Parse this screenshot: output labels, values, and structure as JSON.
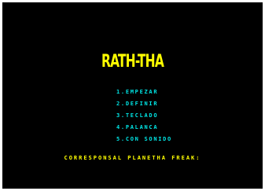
{
  "game": {
    "title": "RATH-THA",
    "menu": [
      {
        "label": "1.EMPEZAR"
      },
      {
        "label": "2.DEFINIR"
      },
      {
        "label": "3.TECLADO"
      },
      {
        "label": "4.PALANCA"
      },
      {
        "label": "5.CON SONIDO"
      }
    ],
    "footer": "CORRESPONSAL PLANETHA FREAK:"
  },
  "colors": {
    "border": "#ffffff",
    "background": "#000000",
    "title": "#ffff00",
    "menu": "#00e5e5",
    "footer": "#ffff00"
  }
}
